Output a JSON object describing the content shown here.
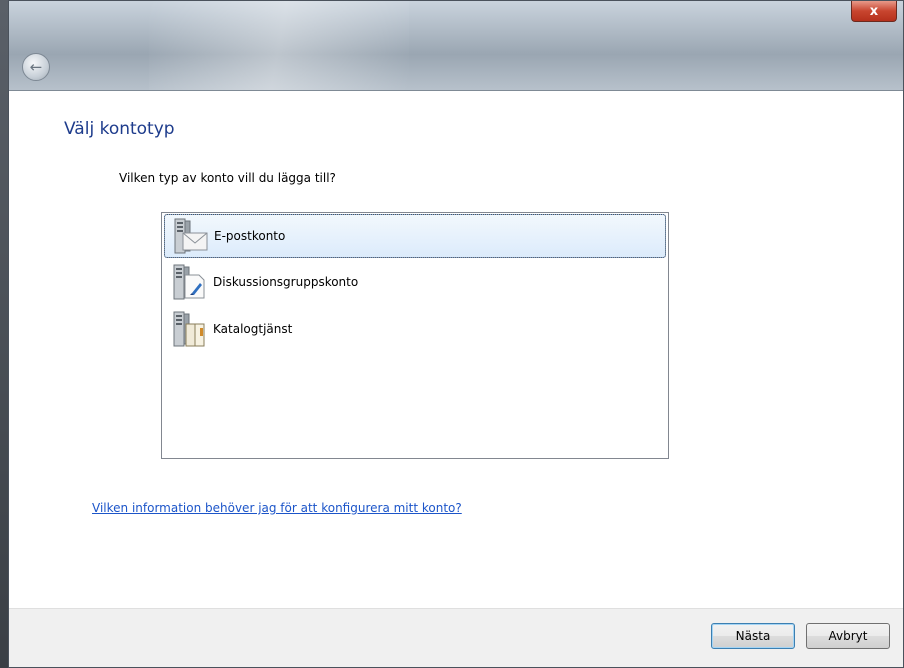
{
  "window": {
    "close_label": "x"
  },
  "page": {
    "title": "Välj kontotyp",
    "question": "Vilken typ av konto vill du lägga till?"
  },
  "account_types": [
    {
      "label": "E-postkonto",
      "icon": "mail-server-icon",
      "selected": true
    },
    {
      "label": "Diskussionsgruppskonto",
      "icon": "newsgroup-server-icon",
      "selected": false
    },
    {
      "label": "Katalogtjänst",
      "icon": "directory-server-icon",
      "selected": false
    }
  ],
  "help_link": "Vilken information behöver jag för att konfigurera mitt konto?",
  "buttons": {
    "next": "Nästa",
    "cancel": "Avbryt"
  },
  "colors": {
    "title": "#1e3c8c",
    "link": "#1c55c9",
    "selection_border": "#84acdd"
  }
}
